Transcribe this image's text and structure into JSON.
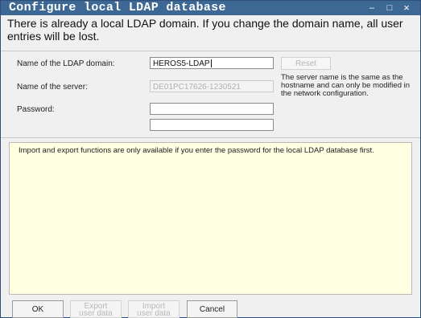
{
  "window": {
    "title": "Configure local LDAP database",
    "controls": {
      "minimize": "–",
      "maximize": "□",
      "close": "×"
    }
  },
  "warning": "There is already a local LDAP domain. If you change the domain name, all user entries will be lost.",
  "form": {
    "domain_label": "Name of the LDAP domain:",
    "domain_value": "HEROS5-LDAP",
    "server_label": "Name of the server:",
    "server_value": "DE01PC17626-1230521",
    "password_label": "Password:",
    "password_value": "",
    "password_confirm_value": "",
    "reset_label": "Reset",
    "server_note": "The server name is the same as the hostname and can only be modified in the network configuration."
  },
  "info": "Import and export functions are only available if you enter the password for the local LDAP database first.",
  "footer": {
    "ok": "OK",
    "export_line1": "Export",
    "export_line2": "user data",
    "import_line1": "Import",
    "import_line2": "user data",
    "cancel": "Cancel"
  }
}
